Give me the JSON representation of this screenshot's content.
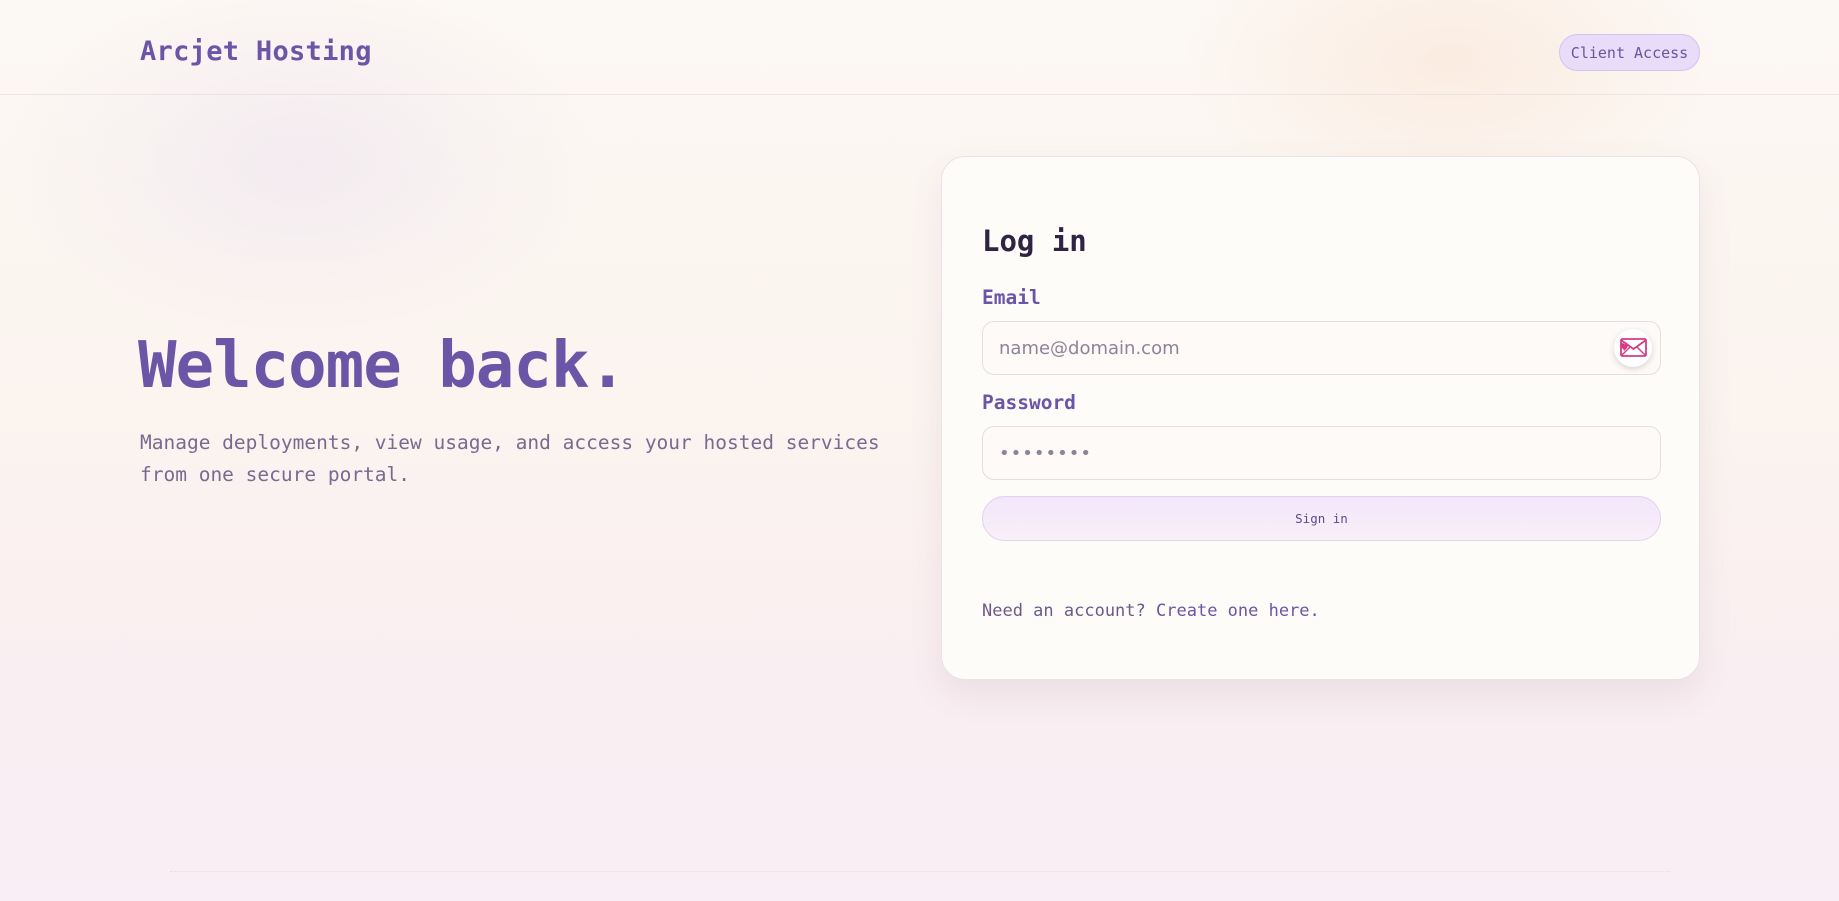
{
  "header": {
    "brand": "Arcjet Hosting",
    "client_access_label": "Client Access"
  },
  "hero": {
    "title": "Welcome back.",
    "subtitle": "Manage deployments, view usage, and access your hosted services from one secure portal."
  },
  "login": {
    "title": "Log in",
    "email_label": "Email",
    "email_placeholder": "name@domain.com",
    "email_value": "",
    "password_label": "Password",
    "password_placeholder": "••••••••",
    "password_value": "",
    "submit_label": "Sign in",
    "footer_prompt": "Need an account?",
    "footer_link": "Create one here."
  },
  "colors": {
    "accent": "#6c54a6",
    "heading": "#2f2444",
    "badge_pink": "#d63a86"
  },
  "icons": {
    "email_badge": "envelope-heart-icon"
  }
}
